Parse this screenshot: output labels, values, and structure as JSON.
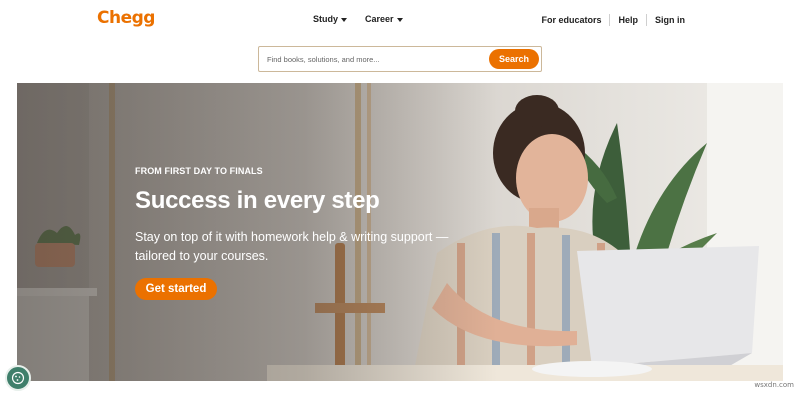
{
  "brand": {
    "logo": "Chegg",
    "accent": "#eb7100"
  },
  "nav": {
    "study": "Study",
    "career": "Career",
    "for_educators": "For educators",
    "help": "Help",
    "sign_in": "Sign in"
  },
  "search": {
    "placeholder": "Find books, solutions, and more...",
    "button": "Search"
  },
  "hero": {
    "eyebrow": "FROM FIRST DAY TO FINALS",
    "headline": "Success in every step",
    "subtext": "Stay on top of it with homework help & writing support —tailored to your courses.",
    "cta": "Get started"
  },
  "icons": {
    "cookie": "cookie-settings-icon",
    "caret": "chevron-down-icon"
  },
  "watermark": "wsxdn.com"
}
